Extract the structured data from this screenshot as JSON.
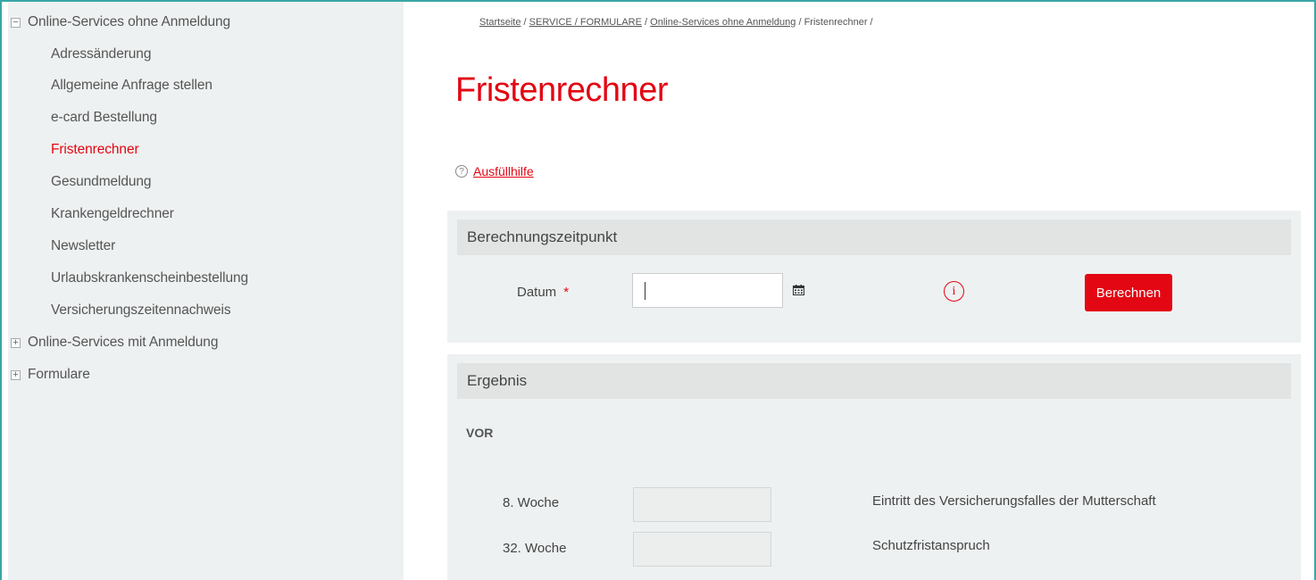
{
  "sidebar": {
    "sections": [
      {
        "label": "Online-Services ohne Anmeldung",
        "toggle": "−"
      },
      {
        "label": "Online-Services mit Anmeldung",
        "toggle": "+"
      },
      {
        "label": "Formulare",
        "toggle": "+"
      }
    ],
    "items": [
      {
        "label": "Adressänderung"
      },
      {
        "label": "Allgemeine Anfrage stellen"
      },
      {
        "label": "e-card Bestellung"
      },
      {
        "label": "Fristenrechner",
        "active": true
      },
      {
        "label": "Gesundmeldung"
      },
      {
        "label": "Krankengeldrechner"
      },
      {
        "label": "Newsletter"
      },
      {
        "label": "Urlaubskrankenscheinbestellung"
      },
      {
        "label": "Versicherungszeitennachweis"
      }
    ]
  },
  "breadcrumb": {
    "items": [
      "Startseite",
      "SERVICE / FORMULARE",
      "Online-Services ohne Anmeldung"
    ],
    "current": "Fristenrechner",
    "separator": " / "
  },
  "page": {
    "title": "Fristenrechner",
    "help_icon": "?",
    "help_link": "Ausfüllhilfe"
  },
  "calc_panel": {
    "heading": "Berechnungszeitpunkt",
    "date_label": "Datum",
    "required_mark": "*",
    "date_value": "",
    "info_icon": "i",
    "submit_label": "Berechnen"
  },
  "result_panel": {
    "heading": "Ergebnis",
    "section_label": "VOR",
    "rows": [
      {
        "week": "8. Woche",
        "value": "",
        "description": "Eintritt des Versicherungsfalles der Mutterschaft"
      },
      {
        "week": "32. Woche",
        "value": "",
        "description": "Schutzfristanspruch"
      }
    ]
  },
  "colors": {
    "accent": "#e30613",
    "sidebar_bg": "#eef1f1",
    "panel_head_bg": "#e2e4e4",
    "frame": "#3aa6a6"
  }
}
